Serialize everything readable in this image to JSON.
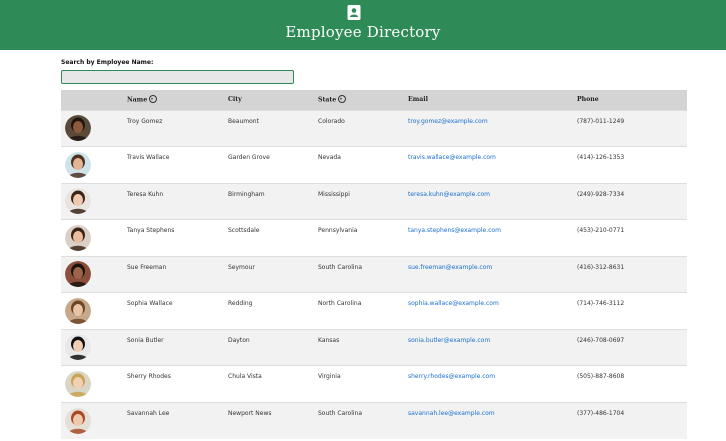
{
  "header": {
    "title": "Employee Directory",
    "icon": "contact-book-icon"
  },
  "search": {
    "label": "Search by Employee Name:",
    "value": "",
    "placeholder": ""
  },
  "table": {
    "columns": [
      "",
      "Name",
      "City",
      "State",
      "Email",
      "Phone"
    ],
    "sortable_columns": [
      "Name",
      "State"
    ],
    "rows": [
      {
        "name": "Troy Gomez",
        "city": "Beaumont",
        "state": "Colorado",
        "email": "troy.gomez@example.com",
        "phone": "(787)-011-1249"
      },
      {
        "name": "Travis Wallace",
        "city": "Garden Grove",
        "state": "Nevada",
        "email": "travis.wallace@example.com",
        "phone": "(414)-126-1353"
      },
      {
        "name": "Teresa Kuhn",
        "city": "Birmingham",
        "state": "Mississippi",
        "email": "teresa.kuhn@example.com",
        "phone": "(249)-928-7334"
      },
      {
        "name": "Tanya Stephens",
        "city": "Scottsdale",
        "state": "Pennsylvania",
        "email": "tanya.stephens@example.com",
        "phone": "(453)-210-0771"
      },
      {
        "name": "Sue Freeman",
        "city": "Seymour",
        "state": "South Carolina",
        "email": "sue.freeman@example.com",
        "phone": "(416)-312-8631"
      },
      {
        "name": "Sophia Wallace",
        "city": "Redding",
        "state": "North Carolina",
        "email": "sophia.wallace@example.com",
        "phone": "(714)-746-3112"
      },
      {
        "name": "Sonia Butler",
        "city": "Dayton",
        "state": "Kansas",
        "email": "sonia.butler@example.com",
        "phone": "(246)-708-0697"
      },
      {
        "name": "Sherry Rhodes",
        "city": "Chula Vista",
        "state": "Virginia",
        "email": "sherry.rhodes@example.com",
        "phone": "(505)-887-8608"
      },
      {
        "name": "Savannah Lee",
        "city": "Newport News",
        "state": "South Carolina",
        "email": "savannah.lee@example.com",
        "phone": "(377)-486-1704"
      }
    ]
  },
  "colors": {
    "header_bg": "#2e8b57",
    "link": "#1a6fd4",
    "table_header_bg": "#d4d4d4",
    "row_alt_bg": "#f2f2f2"
  }
}
